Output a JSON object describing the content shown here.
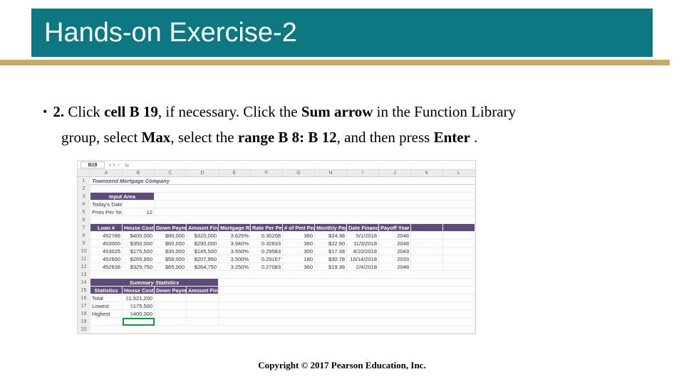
{
  "slide": {
    "title": "Hands-on Exercise-2",
    "step_num": "2.",
    "line1_a": " Click ",
    "line1_b": "cell B 19",
    "line1_c": ", if necessary. Click the ",
    "line1_d": "Sum arrow",
    "line1_e": " in the Function Library",
    "line2_a": "group, select ",
    "line2_b": "Max",
    "line2_c": ", select the ",
    "line2_d": "range B 8: B 12",
    "line2_e": ", and then press ",
    "line2_f": "Enter",
    "line2_g": " .",
    "footer": "Copyright © 2017 Pearson Education, Inc."
  },
  "sheet": {
    "namebox": "B19",
    "fx": "fx",
    "cols": [
      "",
      "A",
      "B",
      "C",
      "D",
      "E",
      "F",
      "G",
      "H",
      "I",
      "J",
      "K",
      "L"
    ],
    "row1_title": "Townsend Mortgage Company",
    "input_area": "Input Area",
    "r4": {
      "label": "Today's Date:",
      "val": ""
    },
    "r5": {
      "label": "Pmts Per Year:",
      "val": "12"
    },
    "hdr": [
      "Loan #",
      "House Cost",
      "Down Payment",
      "Amount Financed",
      "Mortgage Rate",
      "Rate Per Period",
      "# of Pmt Periods",
      "Monthly Payment",
      "Date Financed",
      "Payoff Year"
    ],
    "loans": [
      {
        "a": "452786",
        "b": "$400,000",
        "c": "$80,000",
        "d": "$320,000",
        "e": "3.625%",
        "f": "0.30208",
        "g": "360",
        "h": "$24.38",
        "i": "5/1/2018",
        "j": "2048"
      },
      {
        "a": "453000",
        "b": "$350,000",
        "c": "$60,000",
        "d": "$290,000",
        "e": "3.940%",
        "f": "0.32833",
        "g": "360",
        "h": "$22.90",
        "i": "11/3/2018",
        "j": "2048"
      },
      {
        "a": "453025",
        "b": "$175,500",
        "c": "$30,000",
        "d": "$145,500",
        "e": "3.550%",
        "f": "0.29583",
        "g": "300",
        "h": "$17.38",
        "i": "4/10/2018",
        "j": "2043"
      },
      {
        "a": "452600",
        "b": "$265,950",
        "c": "$58,000",
        "d": "$207,950",
        "e": "3.500%",
        "f": "0.29167",
        "g": "180",
        "h": "$30.78",
        "i": "10/14/2018",
        "j": "2033"
      },
      {
        "a": "452638",
        "b": "$329,750",
        "c": "$65,000",
        "d": "$264,750",
        "e": "3.250%",
        "f": "0.27083",
        "g": "360",
        "h": "$19.38",
        "i": "2/4/2018",
        "j": "2048"
      }
    ],
    "summary_title": "Summary Statistics",
    "sub_hdr": [
      "Statistics",
      "House Cost",
      "Down Payment",
      "Amount Financed"
    ],
    "totals": {
      "label": "Total",
      "b": "1,521,200"
    },
    "lowest": {
      "label": "Lowest",
      "b": "175,500"
    },
    "highest": {
      "label": "Highest",
      "b": "400,000"
    }
  }
}
